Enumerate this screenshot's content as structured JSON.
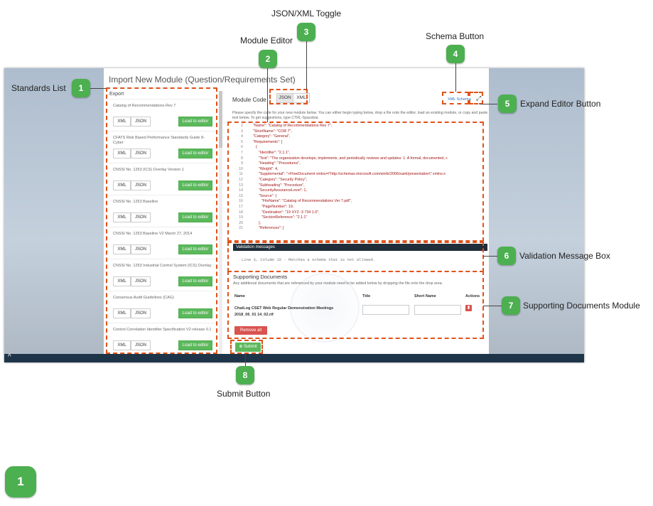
{
  "app": {
    "title": "Import New Module (Question/Requirements Set)",
    "export_label": "Export",
    "bottom_chevron": "^"
  },
  "standards": [
    {
      "name": "Catalog of Recommendations Rev 7",
      "xml": "XML",
      "json": "JSON",
      "load": "Load to editor"
    },
    {
      "name": "CFATS Risk Based Performance Standards Guide 8-Cyber",
      "xml": "XML",
      "json": "JSON",
      "load": "Load to editor"
    },
    {
      "name": "CNSSI No. 1253 (ICS) Overlay Version 1",
      "xml": "XML",
      "json": "JSON",
      "load": "Load to editor"
    },
    {
      "name": "CNSSI No. 1253 Baseline",
      "xml": "XML",
      "json": "JSON",
      "load": "Load to editor"
    },
    {
      "name": "CNSSI No. 1253 Baseline V2 March 27, 2014",
      "xml": "XML",
      "json": "JSON",
      "load": "Load to editor"
    },
    {
      "name": "CNSSI No. 1253 Industrial Control System (ICS) Overlay",
      "xml": "XML",
      "json": "JSON",
      "load": "Load to editor"
    },
    {
      "name": "Consensus Audit Guidelines (CAG)",
      "xml": "XML",
      "json": "JSON",
      "load": "Load to editor"
    },
    {
      "name": "Control Correlation Identifier Specification V2 release 0.1",
      "xml": "XML",
      "json": "JSON",
      "load": "Load to editor"
    }
  ],
  "editor": {
    "module_code_label": "Module Code",
    "toggle_json": "JSON",
    "toggle_xml": "XML",
    "schema_link": "XML Schema",
    "expand_icon": "⤢",
    "description": "Please specify the code for your new module below. You can either begin typing below, drop a file onto the editor, load an existing module, or copy and paste text below. To get suggestions, type CTRL-Spacebar.",
    "lines": [
      {
        "n": "2",
        "t": "\"Name\": \"Catalog of Recommendations Rev 7\","
      },
      {
        "n": "3",
        "t": "\"ShortName\": \"COR 7\","
      },
      {
        "n": "4",
        "t": "\"Category\": \"General\","
      },
      {
        "n": "5",
        "t": "\"Requirements\": ["
      },
      {
        "n": "6",
        "t": "{"
      },
      {
        "n": "7",
        "t": "\"Identifier\": \"2.1.1\","
      },
      {
        "n": "8",
        "t": "\"Text\": \"The organization develops, implements, and periodically reviews and updates:  1. A formal, documented, c"
      },
      {
        "n": "9",
        "t": "\"Heading\": \"Procedures\","
      },
      {
        "n": "10",
        "t": "\"Weight\": 4,"
      },
      {
        "n": "11",
        "t": "\"Supplemental\": \"<FlowDocument xmlns=\\\"http://schemas.microsoft.com/winfx/2006/xaml/presentation\\\" xmlns:x"
      },
      {
        "n": "12",
        "t": "\"Category\": \"Security Policy\","
      },
      {
        "n": "13",
        "t": "\"Subheading\": \"Procedure\","
      },
      {
        "n": "14",
        "t": "\"SecurityAssuranceLevel\": 1,"
      },
      {
        "n": "15",
        "t": "\"Source\": {"
      },
      {
        "n": "16",
        "t": "\"FileName\": \"Catalog of Recommendations Ver 7.pdf\","
      },
      {
        "n": "17",
        "t": "\"PageNumber\": 19,"
      },
      {
        "n": "18",
        "t": "\"Destination\": \"19 XYZ -3 734 1.0\","
      },
      {
        "n": "19",
        "t": "\"SectionReference\": \"2.1.1\""
      },
      {
        "n": "20",
        "t": "},"
      },
      {
        "n": "21",
        "t": "\"References\": ["
      }
    ]
  },
  "validation": {
    "header": "Validation messages",
    "message": "Line 3, Column 15 - Matches a schema that is not allowed."
  },
  "supporting": {
    "title": "Supporting Documents",
    "description": "Any additional documents that are referenced by your module need to be added below by dropping the file onto the drop area.",
    "columns": [
      "Name",
      "Title",
      "Short Name",
      "Actions"
    ],
    "file_name": "ChatLog CSET Web Regular Demonstration Meetings 2018_06_01 14_02.rtf",
    "remove_all": "Remove all"
  },
  "submit_label": "⊕ Submit",
  "annotations": [
    {
      "num": "1",
      "label": "Standards List"
    },
    {
      "num": "2",
      "label": "Module Editor"
    },
    {
      "num": "3",
      "label": "JSON/XML Toggle"
    },
    {
      "num": "4",
      "label": "Schema Button"
    },
    {
      "num": "5",
      "label": "Expand Editor Button"
    },
    {
      "num": "6",
      "label": "Validation Message Box"
    },
    {
      "num": "7",
      "label": "Supporting Documents Module"
    },
    {
      "num": "8",
      "label": "Submit Button"
    }
  ],
  "footer_marker": "1",
  "colors": {
    "accent_green": "#4caf50",
    "annotation_orange": "#e0521a",
    "button_green": "#5cb85c",
    "danger_red": "#d9534f"
  }
}
